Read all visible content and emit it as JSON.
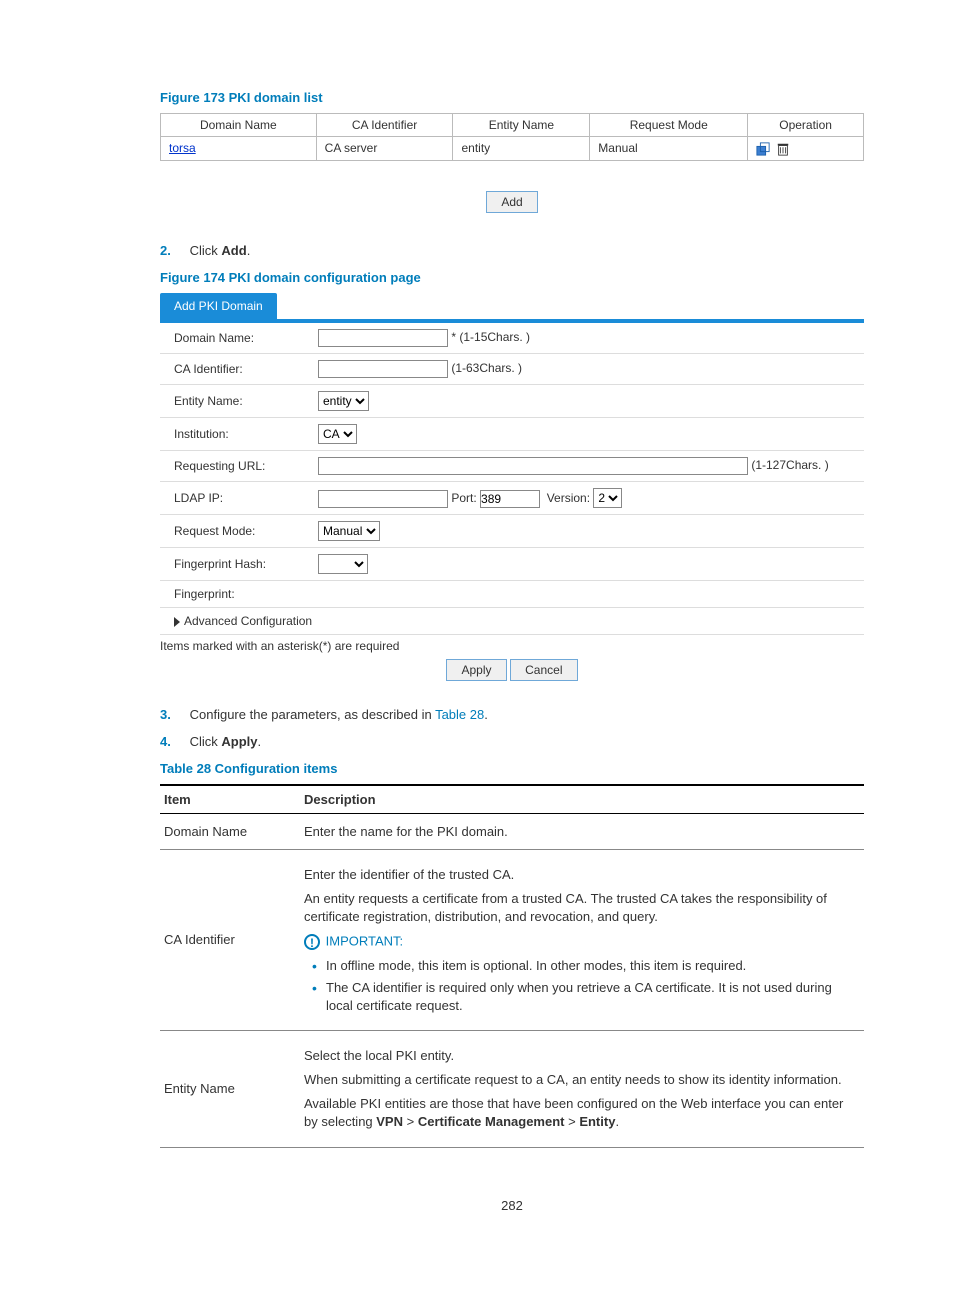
{
  "figure173": {
    "title": "Figure 173 PKI domain list",
    "headers": [
      "Domain Name",
      "CA Identifier",
      "Entity Name",
      "Request Mode",
      "Operation"
    ],
    "row": {
      "domain": "torsa",
      "ca": "CA server",
      "entity": "entity",
      "mode": "Manual"
    },
    "add_label": "Add"
  },
  "step2": {
    "num": "2.",
    "prefix": "Click ",
    "bold": "Add",
    "suffix": "."
  },
  "figure174": {
    "title": "Figure 174 PKI domain configuration page",
    "tab": "Add PKI Domain",
    "labels": {
      "domain_name": "Domain Name:",
      "ca_id": "CA Identifier:",
      "entity_name": "Entity Name:",
      "institution": "Institution:",
      "req_url": "Requesting URL:",
      "ldap_ip": "LDAP IP:",
      "port": "Port:",
      "version": "Version:",
      "req_mode": "Request Mode:",
      "fp_hash": "Fingerprint Hash:",
      "fp": "Fingerprint:",
      "adv": "Advanced Configuration"
    },
    "hints": {
      "domain_name": "* (1-15Chars. )",
      "ca_id": "(1-63Chars. )",
      "req_url": "(1-127Chars. )"
    },
    "values": {
      "entity": "entity",
      "institution": "CA",
      "port": "389",
      "version": "2",
      "req_mode": "Manual"
    },
    "note": "Items marked with an asterisk(*) are required",
    "apply": "Apply",
    "cancel": "Cancel"
  },
  "step3": {
    "num": "3.",
    "prefix": "Configure the parameters, as described in ",
    "link": "Table 28",
    "suffix": "."
  },
  "step4": {
    "num": "4.",
    "prefix": "Click ",
    "bold": "Apply",
    "suffix": "."
  },
  "table28": {
    "title": "Table 28 Configuration items",
    "headers": {
      "item": "Item",
      "desc": "Description"
    },
    "rows": {
      "r1": {
        "item": "Domain Name",
        "desc": "Enter the name for the PKI domain."
      },
      "r2": {
        "item": "CA Identifier",
        "p1": "Enter the identifier of the trusted CA.",
        "p2": "An entity requests a certificate from a trusted CA. The trusted CA takes the responsibility of certificate registration, distribution, and revocation, and query.",
        "important": "IMPORTANT:",
        "b1": "In offline mode, this item is optional. In other modes, this item is required.",
        "b2": "The CA identifier is required only when you retrieve a CA certificate. It is not used during local certificate request."
      },
      "r3": {
        "item": "Entity Name",
        "p1": "Select the local PKI entity.",
        "p2": "When submitting a certificate request to a CA, an entity needs to show its identity information.",
        "p3a": "Available PKI entities are those that have been configured on the Web interface you can enter by selecting ",
        "p3b": "VPN",
        "p3c": " > ",
        "p3d": "Certificate Management",
        "p3e": " > ",
        "p3f": "Entity",
        "p3g": "."
      }
    }
  },
  "page": "282"
}
